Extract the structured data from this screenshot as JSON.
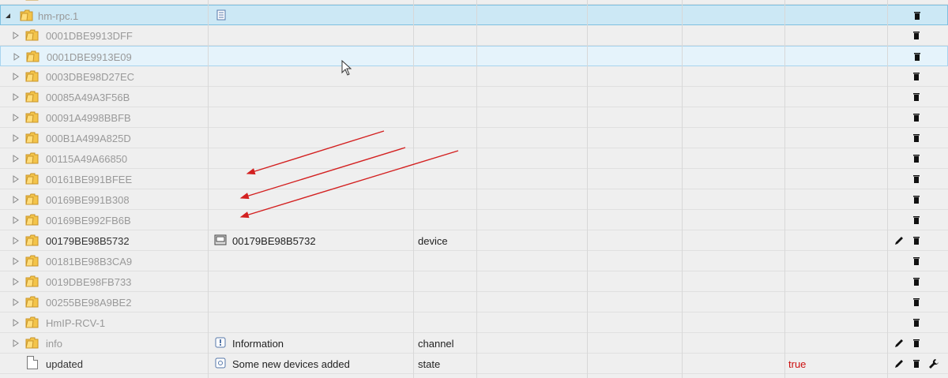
{
  "tree": {
    "root": {
      "label": "hm-rpc.1"
    },
    "children": [
      {
        "id": "0001DBE9913DFF"
      },
      {
        "id": "0001DBE9913E09"
      },
      {
        "id": "0003DBE98D27EC"
      },
      {
        "id": "00085A49A3F56B"
      },
      {
        "id": "00091A4998BBFB"
      },
      {
        "id": "000B1A499A825D"
      },
      {
        "id": "00115A49A66850"
      },
      {
        "id": "00161BE991BFEE"
      },
      {
        "id": "00169BE991B308"
      },
      {
        "id": "00169BE992FB6B"
      },
      {
        "id": "00179BE98B5732",
        "name": "00179BE98B5732",
        "type": "device"
      },
      {
        "id": "00181BE98B3CA9"
      },
      {
        "id": "0019DBE98FB733"
      },
      {
        "id": "00255BE98A9BE2"
      },
      {
        "id": "HmIP-RCV-1"
      },
      {
        "id": "info",
        "name": "Information",
        "type": "channel"
      },
      {
        "id": "updated",
        "name": "Some new devices added",
        "type": "state",
        "value": "true"
      }
    ]
  },
  "icons": {
    "expand": "triangle-right-icon",
    "collapse": "triangle-down-icon",
    "folder": "folder-icon",
    "file": "file-icon",
    "edit": "pencil-icon",
    "delete": "trash-icon",
    "custom": "wrench-icon"
  },
  "colors": {
    "selection": "#cce8f5",
    "value_true": "#cc1010",
    "annotation_arrow": "#d32020"
  }
}
